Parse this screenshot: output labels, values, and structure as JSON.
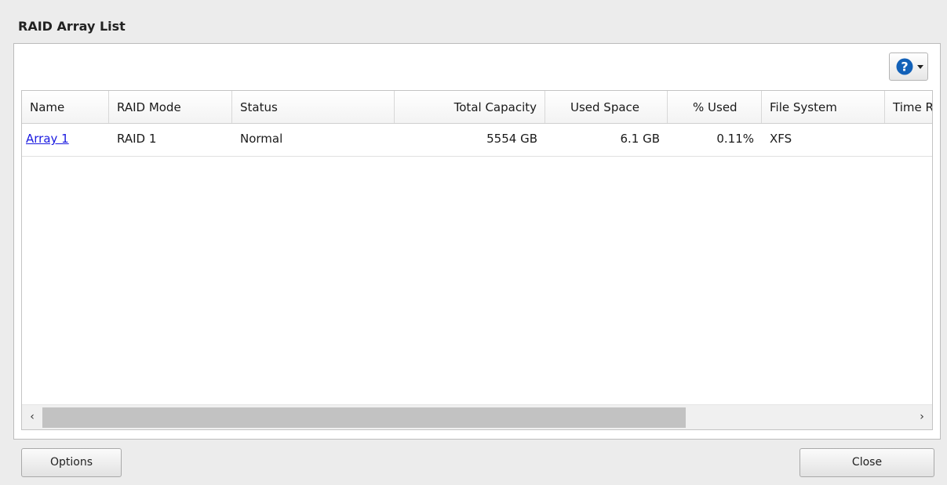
{
  "dialog": {
    "title": "RAID Array List"
  },
  "toolbar": {
    "help_icon": "help-icon",
    "dropdown_icon": "chevron-down-icon"
  },
  "table": {
    "columns": [
      "Name",
      "RAID Mode",
      "Status",
      "Total Capacity",
      "Used Space",
      "% Used",
      "File System",
      "Time R"
    ],
    "rows": [
      {
        "name": "Array 1",
        "raid_mode": "RAID 1",
        "status": "Normal",
        "total_capacity": "5554 GB",
        "used_space": "6.1 GB",
        "percent_used": "0.11%",
        "file_system": "XFS",
        "time_remaining": ""
      }
    ]
  },
  "scrollbar": {
    "left_arrow": "‹",
    "right_arrow": "›",
    "thumb_fraction": 0.74
  },
  "buttons": {
    "options_label": "Options",
    "close_label": "Close"
  },
  "colors": {
    "link": "#1a1ae0",
    "help_icon": "#1261b8"
  }
}
